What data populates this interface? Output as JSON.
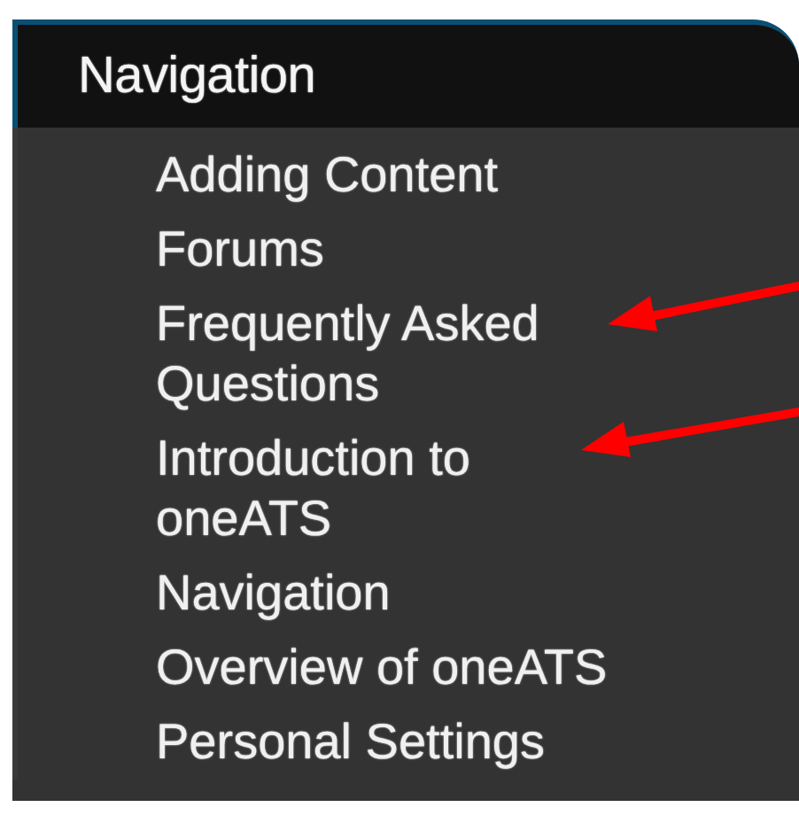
{
  "panel": {
    "title": "Navigation"
  },
  "items": [
    {
      "label": "Adding Content",
      "marked": false
    },
    {
      "label": "Forums",
      "marked": false
    },
    {
      "label": "Frequently Asked Questions",
      "marked": true
    },
    {
      "label": "Introduction to oneATS",
      "marked": true
    },
    {
      "label": "Navigation",
      "marked": false
    },
    {
      "label": "Overview of oneATS",
      "marked": false
    },
    {
      "label": "Personal Settings",
      "marked": false
    }
  ]
}
